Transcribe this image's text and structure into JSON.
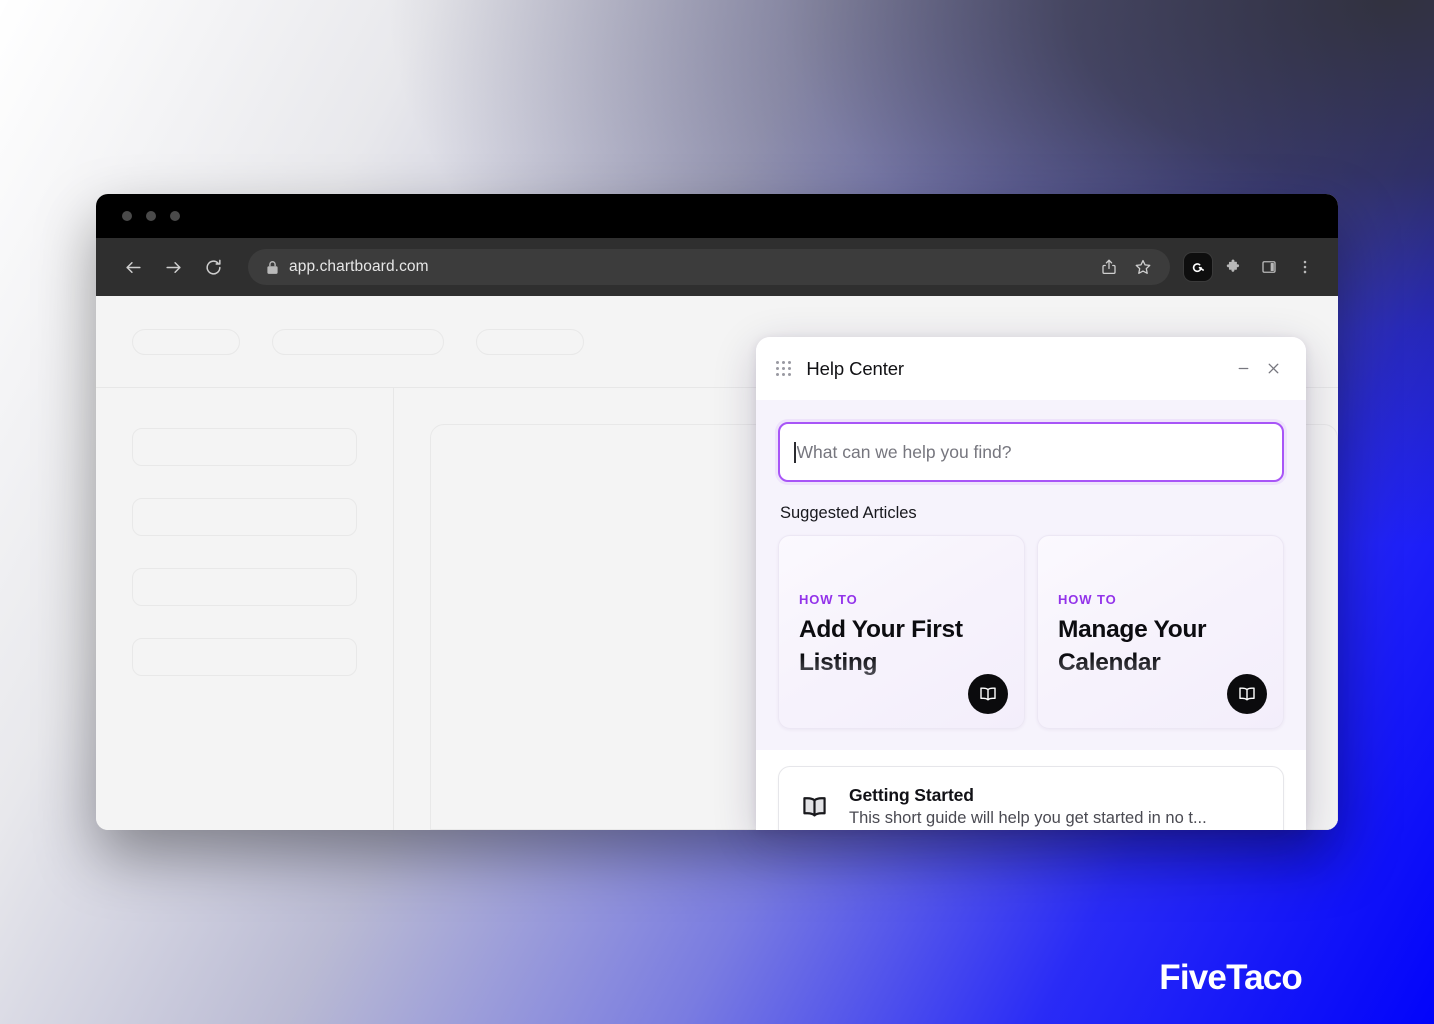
{
  "watermark": {
    "text": "FiveTaco"
  },
  "browser": {
    "window_controls": [
      "close",
      "minimize",
      "maximize"
    ],
    "nav": {
      "back_label": "Back",
      "forward_label": "Forward",
      "reload_label": "Reload"
    },
    "address": {
      "url": "app.chartboard.com",
      "secure_icon": "lock-icon",
      "share_icon": "share-icon",
      "bookmark_icon": "star-icon"
    },
    "toolbar_icons": [
      {
        "name": "extension-badge-icon",
        "label": "Extension"
      },
      {
        "name": "puzzle-icon",
        "label": "Extensions"
      },
      {
        "name": "sidebar-panel-icon",
        "label": "Side panel"
      },
      {
        "name": "kebab-menu-icon",
        "label": "Customize and control"
      }
    ]
  },
  "widget": {
    "title": "Help Center",
    "handle_icon": "grid-dots-icon",
    "minimize_label": "Minimize",
    "close_label": "Close",
    "search": {
      "value": "",
      "placeholder": "What can we help you find?",
      "focused": true,
      "accent_color": "#a855f7"
    },
    "suggested": {
      "heading": "Suggested Articles",
      "cards": [
        {
          "kicker": "HOW TO",
          "title": "Add Your First Listing",
          "icon": "open-book-icon"
        },
        {
          "kicker": "HOW TO",
          "title": "Manage Your Calendar",
          "icon": "open-book-icon"
        }
      ]
    },
    "articles": [
      {
        "icon": "open-book-icon",
        "title": "Getting Started",
        "description": "This short guide will help you get started in no t..."
      }
    ]
  }
}
